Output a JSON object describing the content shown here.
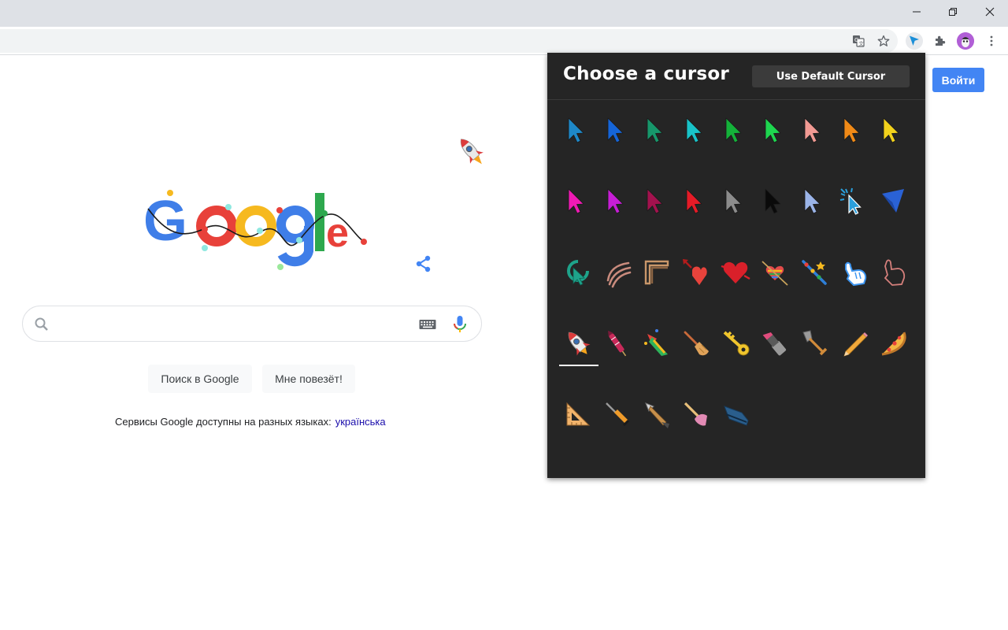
{
  "window": {
    "controls": [
      "minimize",
      "restore",
      "close"
    ]
  },
  "toolbar": {
    "icons": [
      "translate-icon",
      "star-icon",
      "cursor-extension-icon",
      "puzzle-icon",
      "avatar",
      "menu-icon"
    ]
  },
  "google": {
    "signin_label": "Войти",
    "search_button_label": "Поиск в Google",
    "lucky_button_label": "Мне повезёт!",
    "language_notice": "Сервисы Google доступны на разных языках:",
    "language_link": "українська",
    "search_placeholder": "",
    "doodle_text": "Google"
  },
  "popup": {
    "title": "Choose a cursor",
    "default_button_label": "Use Default Cursor",
    "selected_index": 27,
    "cursors": [
      {
        "name": "arrow-teal-blue",
        "kind": "arrow",
        "color": "#1e88c8"
      },
      {
        "name": "arrow-blue",
        "kind": "arrow",
        "color": "#1565d8"
      },
      {
        "name": "arrow-green-dark",
        "kind": "arrow",
        "color": "#17976b"
      },
      {
        "name": "arrow-cyan",
        "kind": "arrow",
        "color": "#19c3c8"
      },
      {
        "name": "arrow-green",
        "kind": "arrow",
        "color": "#14b23a"
      },
      {
        "name": "arrow-lime",
        "kind": "arrow",
        "color": "#1ed64f"
      },
      {
        "name": "arrow-salmon",
        "kind": "arrow",
        "color": "#f19a93"
      },
      {
        "name": "arrow-orange",
        "kind": "arrow",
        "color": "#f08a17"
      },
      {
        "name": "arrow-yellow",
        "kind": "arrow",
        "color": "#f2d21c"
      },
      {
        "name": "arrow-magenta",
        "kind": "arrow",
        "color": "#ef1ab4"
      },
      {
        "name": "arrow-purple",
        "kind": "arrow",
        "color": "#c71ed6"
      },
      {
        "name": "arrow-maroon",
        "kind": "arrow",
        "color": "#a3124e"
      },
      {
        "name": "arrow-red",
        "kind": "arrow",
        "color": "#e51b27"
      },
      {
        "name": "arrow-gray",
        "kind": "arrow",
        "color": "#8c8c8c"
      },
      {
        "name": "arrow-black",
        "kind": "arrow",
        "color": "#0a0a0a"
      },
      {
        "name": "arrow-light-blue",
        "kind": "arrow",
        "color": "#9bb4e8"
      },
      {
        "name": "arrow-sparkle-blue",
        "kind": "sparkle",
        "color": "#2a9fdc"
      },
      {
        "name": "arrow-flat-blue",
        "kind": "flat",
        "color": "#2a62d6"
      },
      {
        "name": "circle-arrow-teal",
        "kind": "circle",
        "color": "#1ea38a"
      },
      {
        "name": "claw-stripes",
        "kind": "stripes",
        "color": "#c98b7d"
      },
      {
        "name": "chevron-brown",
        "kind": "chevron",
        "color": "#c9976a"
      },
      {
        "name": "heart-arrow",
        "kind": "heart-arrow",
        "color": "#e8433c"
      },
      {
        "name": "heart-red",
        "kind": "heart",
        "color": "#d9202a"
      },
      {
        "name": "rainbow-heart",
        "kind": "rainbow",
        "color": "#e34a4a"
      },
      {
        "name": "magic-wand",
        "kind": "wand",
        "color": "#2e7fd8"
      },
      {
        "name": "hand-pointer-blue",
        "kind": "hand",
        "color": "#3d95f0"
      },
      {
        "name": "hand-pointer-outline",
        "kind": "hand-outline",
        "color": "#d47f7b"
      },
      {
        "name": "rocket",
        "kind": "rocket",
        "color": "#dc3b3b"
      },
      {
        "name": "firework",
        "kind": "firework",
        "color": "#c92a5a"
      },
      {
        "name": "party-popper",
        "kind": "popper",
        "color": "#2fb35a"
      },
      {
        "name": "broom",
        "kind": "broom",
        "color": "#e0a35a"
      },
      {
        "name": "key",
        "kind": "key",
        "color": "#f0c52d"
      },
      {
        "name": "lipstick",
        "kind": "lipstick",
        "color": "#e04c7d"
      },
      {
        "name": "shovel",
        "kind": "shovel",
        "color": "#9a9a9a"
      },
      {
        "name": "pencil",
        "kind": "pencil",
        "color": "#f2a93b"
      },
      {
        "name": "pizza",
        "kind": "pizza",
        "color": "#f3b542"
      },
      {
        "name": "set-square",
        "kind": "setsquare",
        "color": "#f1b36b"
      },
      {
        "name": "screwdriver",
        "kind": "screwdriver",
        "color": "#ef9b2a"
      },
      {
        "name": "fountain-pen",
        "kind": "pen",
        "color": "#c7904b"
      },
      {
        "name": "plunger",
        "kind": "plunger",
        "color": "#e28ab4"
      },
      {
        "name": "stapler",
        "kind": "stapler",
        "color": "#2a5e8c"
      }
    ]
  }
}
